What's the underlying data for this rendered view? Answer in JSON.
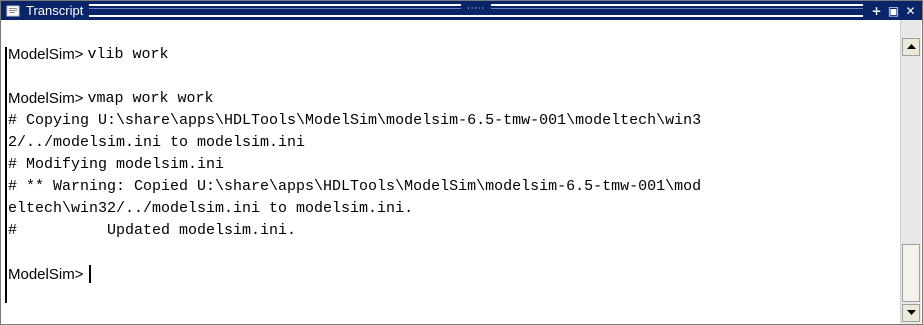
{
  "window": {
    "title": "Transcript"
  },
  "titlebar_buttons": [
    "+",
    "▣",
    "✕"
  ],
  "transcript": {
    "prompt": "ModelSim>",
    "cmd1": "vlib work",
    "cmd2": "vmap work work",
    "out1": "# Copying U:\\share\\apps\\HDLTools\\ModelSim\\modelsim-6.5-tmw-001\\modeltech\\win3",
    "out2": "2/../modelsim.ini to modelsim.ini",
    "out3": "# Modifying modelsim.ini",
    "out4": "# ** Warning: Copied U:\\share\\apps\\HDLTools\\ModelSim\\modelsim-6.5-tmw-001\\mod",
    "out5": "eltech\\win32/../modelsim.ini to modelsim.ini.",
    "out6": "#          Updated modelsim.ini."
  },
  "colors": {
    "titlebar": "#0a246a",
    "background": "#ffffff",
    "text": "#000000"
  },
  "icons": {
    "window": "transcript-icon",
    "scroll_up": "arrow-up-icon",
    "scroll_down": "arrow-down-icon"
  }
}
